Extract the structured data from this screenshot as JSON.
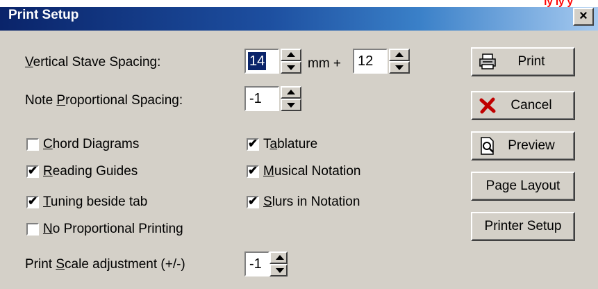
{
  "window": {
    "title": "Print Setup",
    "top_strip_text": "ly ly y",
    "close_label": "×"
  },
  "fields": {
    "vertical_label_key": "V",
    "vertical_label_rest": "ertical Stave Spacing:",
    "vertical_value1": "14",
    "mm_plus": "mm +",
    "vertical_value2": "12",
    "note_label_pre": "Note ",
    "note_label_key": "P",
    "note_label_rest": "roportional Spacing:",
    "note_value": "-1",
    "scale_label_pre": "Print ",
    "scale_label_key": "S",
    "scale_label_rest": "cale adjustment (+/-)",
    "scale_value": "-1"
  },
  "checkboxes": {
    "chord": {
      "key": "C",
      "rest": "hord Diagrams",
      "checked": false
    },
    "reading": {
      "key": "R",
      "rest": "eading Guides",
      "checked": true
    },
    "tuning": {
      "key": "T",
      "rest": "uning beside tab",
      "checked": true
    },
    "noprop": {
      "key": "N",
      "rest": "o Proportional Printing",
      "checked": false
    },
    "tab_pre": "T",
    "tab_key": "a",
    "tab_rest": "blature",
    "tab_checked": true,
    "musical": {
      "key": "M",
      "rest": "usical Notation",
      "checked": true
    },
    "slurs": {
      "key": "S",
      "rest": "lurs in Notation",
      "checked": true
    }
  },
  "buttons": {
    "print": "Print",
    "cancel": "Cancel",
    "preview": "Preview",
    "page_layout": "Page Layout",
    "printer_setup": "Printer Setup"
  },
  "icons": {
    "print": "printer-icon",
    "cancel": "red-x-icon",
    "preview": "magnifier-page-icon"
  },
  "colors": {
    "title_start": "#0a246a",
    "title_end": "#a6caf0",
    "face": "#d4d0c8",
    "cancel_x": "#c00000",
    "selection": "#0a246a"
  }
}
